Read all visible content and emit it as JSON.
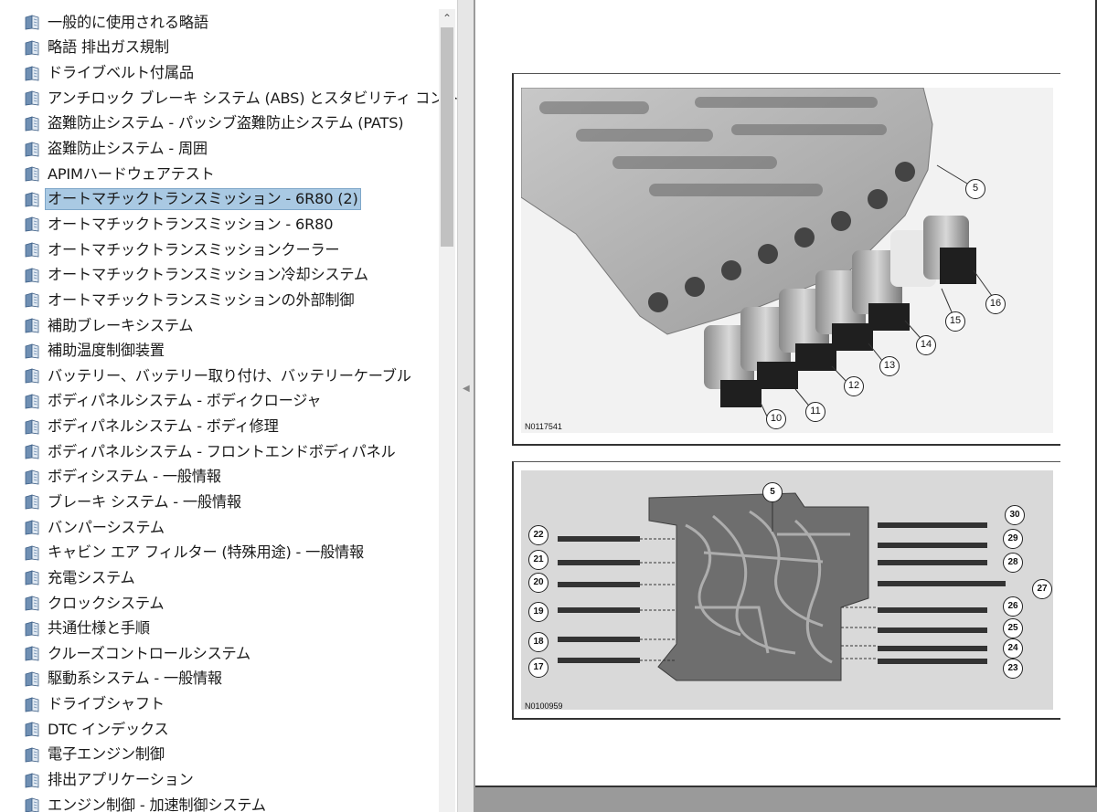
{
  "toc": {
    "items": [
      {
        "label": "一般的に使用される略語",
        "selected": false
      },
      {
        "label": "略語 排出ガス規制",
        "selected": false
      },
      {
        "label": "ドライブベルト付属品",
        "selected": false
      },
      {
        "label": "アンチロック ブレーキ システム (ABS) とスタビリティ コントロール",
        "selected": false
      },
      {
        "label": "盗難防止システム - パッシブ盗難防止システム (PATS)",
        "selected": false
      },
      {
        "label": "盗難防止システム - 周囲",
        "selected": false
      },
      {
        "label": "APIMハードウェアテスト",
        "selected": false
      },
      {
        "label": "オートマチックトランスミッション - 6R80 (2)",
        "selected": true
      },
      {
        "label": "オートマチックトランスミッション - 6R80",
        "selected": false
      },
      {
        "label": "オートマチックトランスミッションクーラー",
        "selected": false
      },
      {
        "label": "オートマチックトランスミッション冷却システム",
        "selected": false
      },
      {
        "label": "オートマチックトランスミッションの外部制御",
        "selected": false
      },
      {
        "label": "補助ブレーキシステム",
        "selected": false
      },
      {
        "label": "補助温度制御装置",
        "selected": false
      },
      {
        "label": "バッテリー、バッテリー取り付け、バッテリーケーブル",
        "selected": false
      },
      {
        "label": "ボディパネルシステム - ボディクロージャ",
        "selected": false
      },
      {
        "label": "ボディパネルシステム - ボディ修理",
        "selected": false
      },
      {
        "label": "ボディパネルシステム - フロントエンドボディパネル",
        "selected": false
      },
      {
        "label": "ボディシステム - 一般情報",
        "selected": false
      },
      {
        "label": "ブレーキ システム - 一般情報",
        "selected": false
      },
      {
        "label": "バンパーシステム",
        "selected": false
      },
      {
        "label": "キャビン エア フィルター (特殊用途) - 一般情報",
        "selected": false
      },
      {
        "label": "充電システム",
        "selected": false
      },
      {
        "label": "クロックシステム",
        "selected": false
      },
      {
        "label": "共通仕様と手順",
        "selected": false
      },
      {
        "label": "クルーズコントロールシステム",
        "selected": false
      },
      {
        "label": "駆動系システム - 一般情報",
        "selected": false
      },
      {
        "label": "ドライブシャフト",
        "selected": false
      },
      {
        "label": "DTC インデックス",
        "selected": false
      },
      {
        "label": "電子エンジン制御",
        "selected": false
      },
      {
        "label": "排出アプリケーション",
        "selected": false
      },
      {
        "label": "エンジン制御 - 加速制御システム",
        "selected": false
      }
    ],
    "icon": "book-page-icon"
  },
  "document": {
    "figure1": {
      "id": "N0117541",
      "callouts": [
        "5",
        "16",
        "15",
        "14",
        "13",
        "12",
        "11",
        "10"
      ]
    },
    "figure2": {
      "id": "N0100959",
      "callouts": [
        "5",
        "30",
        "29",
        "28",
        "27",
        "26",
        "25",
        "24",
        "23",
        "22",
        "21",
        "20",
        "19",
        "18",
        "17"
      ]
    }
  },
  "colors": {
    "selection": "#a9c9e3",
    "doc_background": "#9a9a9a"
  }
}
